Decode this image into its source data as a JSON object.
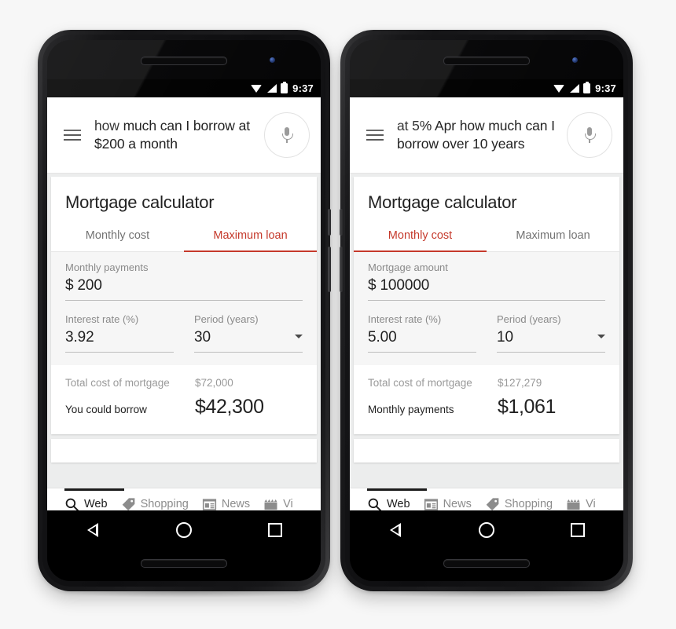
{
  "colors": {
    "page_bg": "#f7f7f7",
    "accent_red": "#c5392b",
    "text_primary": "#212121",
    "text_muted": "#8a8a8a",
    "card_bg": "#ffffff",
    "input_bg": "#f6f6f6"
  },
  "phones": [
    {
      "status_bar": {
        "time": "9:37",
        "icons": [
          "wifi-icon",
          "signal-icon",
          "battery-icon"
        ]
      },
      "search_header": {
        "menu_icon": "hamburger-icon",
        "query": "how much can I borrow at $200 a month",
        "mic_icon": "microphone-icon"
      },
      "card": {
        "title": "Mortgage calculator",
        "tabs": [
          {
            "label": "Monthly cost",
            "active": false
          },
          {
            "label": "Maximum loan",
            "active": true
          }
        ],
        "inputs": {
          "amount": {
            "label": "Monthly payments",
            "currency": "$",
            "value": "200"
          },
          "rate": {
            "label": "Interest rate (%)",
            "value": "3.92"
          },
          "period": {
            "label": "Period (years)",
            "value": "30"
          }
        },
        "results": {
          "secondary": {
            "label": "Total cost of mortgage",
            "value": "$72,000"
          },
          "primary": {
            "label": "You could borrow",
            "value": "$42,300"
          }
        }
      },
      "bottom_tabs": [
        {
          "label": "Web",
          "icon": "search-icon",
          "active": true
        },
        {
          "label": "Shopping",
          "icon": "tag-icon",
          "active": false
        },
        {
          "label": "News",
          "icon": "newspaper-icon",
          "active": false
        },
        {
          "label": "Vi",
          "icon": "video-clapper-icon",
          "active": false
        }
      ],
      "nav_bar": [
        "back-button",
        "home-button",
        "recents-button"
      ]
    },
    {
      "status_bar": {
        "time": "9:37",
        "icons": [
          "wifi-icon",
          "signal-icon",
          "battery-icon"
        ]
      },
      "search_header": {
        "menu_icon": "hamburger-icon",
        "query": "at 5% Apr how much can I borrow over 10 years",
        "mic_icon": "microphone-icon"
      },
      "card": {
        "title": "Mortgage calculator",
        "tabs": [
          {
            "label": "Monthly cost",
            "active": true
          },
          {
            "label": "Maximum loan",
            "active": false
          }
        ],
        "inputs": {
          "amount": {
            "label": "Mortgage amount",
            "currency": "$",
            "value": "100000"
          },
          "rate": {
            "label": "Interest rate (%)",
            "value": "5.00"
          },
          "period": {
            "label": "Period (years)",
            "value": "10"
          }
        },
        "results": {
          "secondary": {
            "label": "Total cost of mortgage",
            "value": "$127,279"
          },
          "primary": {
            "label": "Monthly payments",
            "value": "$1,061"
          }
        }
      },
      "bottom_tabs": [
        {
          "label": "Web",
          "icon": "search-icon",
          "active": true
        },
        {
          "label": "News",
          "icon": "newspaper-icon",
          "active": false
        },
        {
          "label": "Shopping",
          "icon": "tag-icon",
          "active": false
        },
        {
          "label": "Vi",
          "icon": "video-clapper-icon",
          "active": false
        }
      ],
      "nav_bar": [
        "back-button",
        "home-button",
        "recents-button"
      ]
    }
  ]
}
